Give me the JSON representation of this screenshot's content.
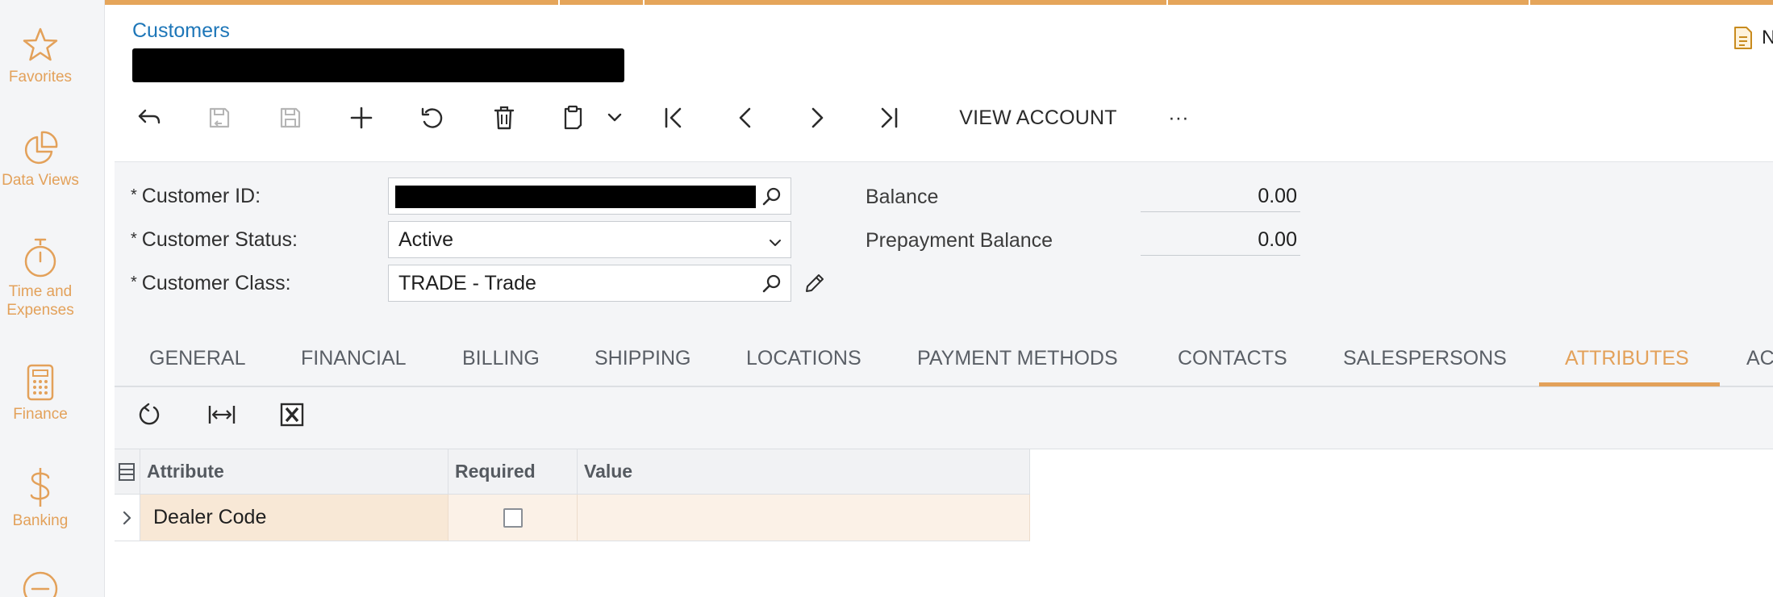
{
  "leftnav": {
    "items": [
      {
        "label": "Favorites",
        "icon": "star-icon"
      },
      {
        "label": "Data Views",
        "icon": "pie-chart-icon"
      },
      {
        "label": "Time and Expenses",
        "icon": "stopwatch-icon"
      },
      {
        "label": "Finance",
        "icon": "calculator-icon"
      },
      {
        "label": "Banking",
        "icon": "dollar-icon"
      }
    ]
  },
  "header": {
    "breadcrumb": "Customers",
    "notes_label": "N"
  },
  "toolbar": {
    "view_account_label": "VIEW ACCOUNT",
    "more_label": "···"
  },
  "form": {
    "customer_id_label": "Customer ID:",
    "customer_status_label": "Customer Status:",
    "customer_status_value": "Active",
    "customer_class_label": "Customer Class:",
    "customer_class_value": "TRADE - Trade",
    "balance_label": "Balance",
    "balance_value": "0.00",
    "prepayment_label": "Prepayment Balance",
    "prepayment_value": "0.00",
    "required_marker": "*"
  },
  "tabs": [
    {
      "label": "GENERAL"
    },
    {
      "label": "FINANCIAL"
    },
    {
      "label": "BILLING"
    },
    {
      "label": "SHIPPING"
    },
    {
      "label": "LOCATIONS"
    },
    {
      "label": "PAYMENT METHODS"
    },
    {
      "label": "CONTACTS"
    },
    {
      "label": "SALESPERSONS"
    },
    {
      "label": "ATTRIBUTES",
      "active": true
    },
    {
      "label": "AC"
    }
  ],
  "grid": {
    "columns": [
      "Attribute",
      "Required",
      "Value"
    ],
    "rows": [
      {
        "attribute": "Dealer Code",
        "required": false,
        "value": ""
      }
    ]
  },
  "colors": {
    "accent": "#e3a15a",
    "link": "#1d76b8",
    "panel_bg": "#f4f5f7",
    "selected_row": "#fbf1e7"
  }
}
